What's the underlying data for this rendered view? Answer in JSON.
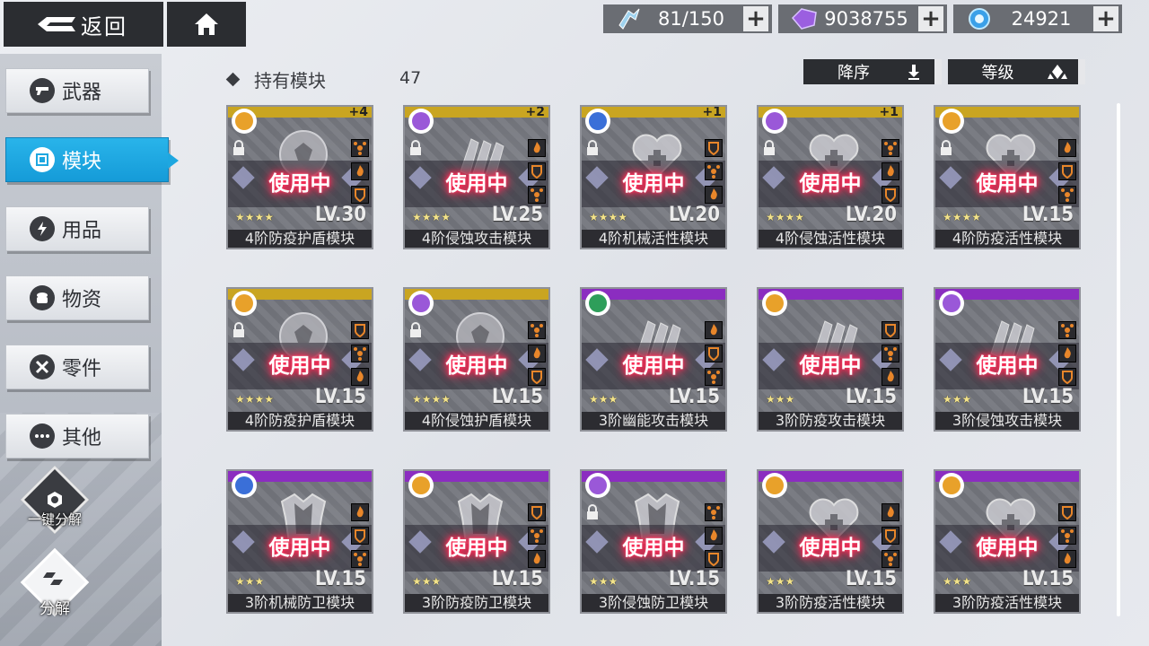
{
  "top_bar": {
    "back_label": "返回",
    "resources": [
      {
        "icon": "stamina-icon",
        "value": "81/150"
      },
      {
        "icon": "crystal-icon",
        "value": "9038755"
      },
      {
        "icon": "energy-orb-icon",
        "value": "24921"
      }
    ]
  },
  "sidebar": {
    "items": [
      {
        "label": "武器",
        "icon": "gun-icon"
      },
      {
        "label": "模块",
        "icon": "module-icon",
        "active": true
      },
      {
        "label": "用品",
        "icon": "lightning-icon"
      },
      {
        "label": "物资",
        "icon": "supply-icon"
      },
      {
        "label": "零件",
        "icon": "tools-icon"
      },
      {
        "label": "其他",
        "icon": "more-icon"
      }
    ],
    "one_click_label": "一键分解",
    "dismantle_label": "分解"
  },
  "list": {
    "title": "持有模块",
    "count": "47",
    "sort_order_label": "降序",
    "sort_key_label": "等级"
  },
  "colors": {
    "accent": "#1ea7e0",
    "gold_band": "#c9a521",
    "purple_band": "#8b2dc0",
    "in_use_glow": "#ff2a55"
  },
  "modules": [
    {
      "name": "4阶防疫护盾模块",
      "level": "LV.30",
      "stars": "★★★★",
      "status": "使用中",
      "plus": "+4",
      "tier": "gold",
      "emblem": "immune",
      "shape": "ball",
      "locked": true
    },
    {
      "name": "4阶侵蚀攻击模块",
      "level": "LV.25",
      "stars": "★★★★",
      "status": "使用中",
      "plus": "+2",
      "tier": "gold",
      "emblem": "erosion",
      "shape": "bullets",
      "locked": true
    },
    {
      "name": "4阶机械活性模块",
      "level": "LV.20",
      "stars": "★★★★",
      "status": "使用中",
      "plus": "+1",
      "tier": "gold",
      "emblem": "mech",
      "shape": "heart",
      "locked": true
    },
    {
      "name": "4阶侵蚀活性模块",
      "level": "LV.20",
      "stars": "★★★★",
      "status": "使用中",
      "plus": "+1",
      "tier": "gold",
      "emblem": "erosion",
      "shape": "heart",
      "locked": true
    },
    {
      "name": "4阶防疫活性模块",
      "level": "LV.15",
      "stars": "★★★★",
      "status": "使用中",
      "plus": "",
      "tier": "gold",
      "emblem": "immune",
      "shape": "heart",
      "locked": true
    },
    {
      "name": "4阶防疫护盾模块",
      "level": "LV.15",
      "stars": "★★★★",
      "status": "使用中",
      "plus": "",
      "tier": "gold",
      "emblem": "immune",
      "shape": "ball",
      "locked": true
    },
    {
      "name": "4阶侵蚀护盾模块",
      "level": "LV.15",
      "stars": "★★★★",
      "status": "使用中",
      "plus": "",
      "tier": "gold",
      "emblem": "erosion",
      "shape": "ball",
      "locked": true
    },
    {
      "name": "3阶幽能攻击模块",
      "level": "LV.15",
      "stars": "★★★",
      "status": "使用中",
      "plus": "",
      "tier": "purple",
      "emblem": "psionic",
      "shape": "bullets",
      "locked": false
    },
    {
      "name": "3阶防疫攻击模块",
      "level": "LV.15",
      "stars": "★★★",
      "status": "使用中",
      "plus": "",
      "tier": "purple",
      "emblem": "immune",
      "shape": "bullets",
      "locked": false
    },
    {
      "name": "3阶侵蚀攻击模块",
      "level": "LV.15",
      "stars": "★★★",
      "status": "使用中",
      "plus": "",
      "tier": "purple",
      "emblem": "erosion",
      "shape": "bullets",
      "locked": false
    },
    {
      "name": "3阶机械防卫模块",
      "level": "LV.15",
      "stars": "★★★",
      "status": "使用中",
      "plus": "",
      "tier": "purple",
      "emblem": "mech",
      "shape": "vest",
      "locked": false
    },
    {
      "name": "3阶防疫防卫模块",
      "level": "LV.15",
      "stars": "★★★",
      "status": "使用中",
      "plus": "",
      "tier": "purple",
      "emblem": "immune",
      "shape": "vest",
      "locked": false
    },
    {
      "name": "3阶侵蚀防卫模块",
      "level": "LV.15",
      "stars": "★★★",
      "status": "使用中",
      "plus": "",
      "tier": "purple",
      "emblem": "erosion",
      "shape": "vest",
      "locked": true
    },
    {
      "name": "3阶防疫活性模块",
      "level": "LV.15",
      "stars": "★★★",
      "status": "使用中",
      "plus": "",
      "tier": "purple",
      "emblem": "immune",
      "shape": "heart",
      "locked": false
    },
    {
      "name": "3阶防疫活性模块",
      "level": "LV.15",
      "stars": "★★★",
      "status": "使用中",
      "plus": "",
      "tier": "purple",
      "emblem": "immune",
      "shape": "heart",
      "locked": false
    }
  ]
}
